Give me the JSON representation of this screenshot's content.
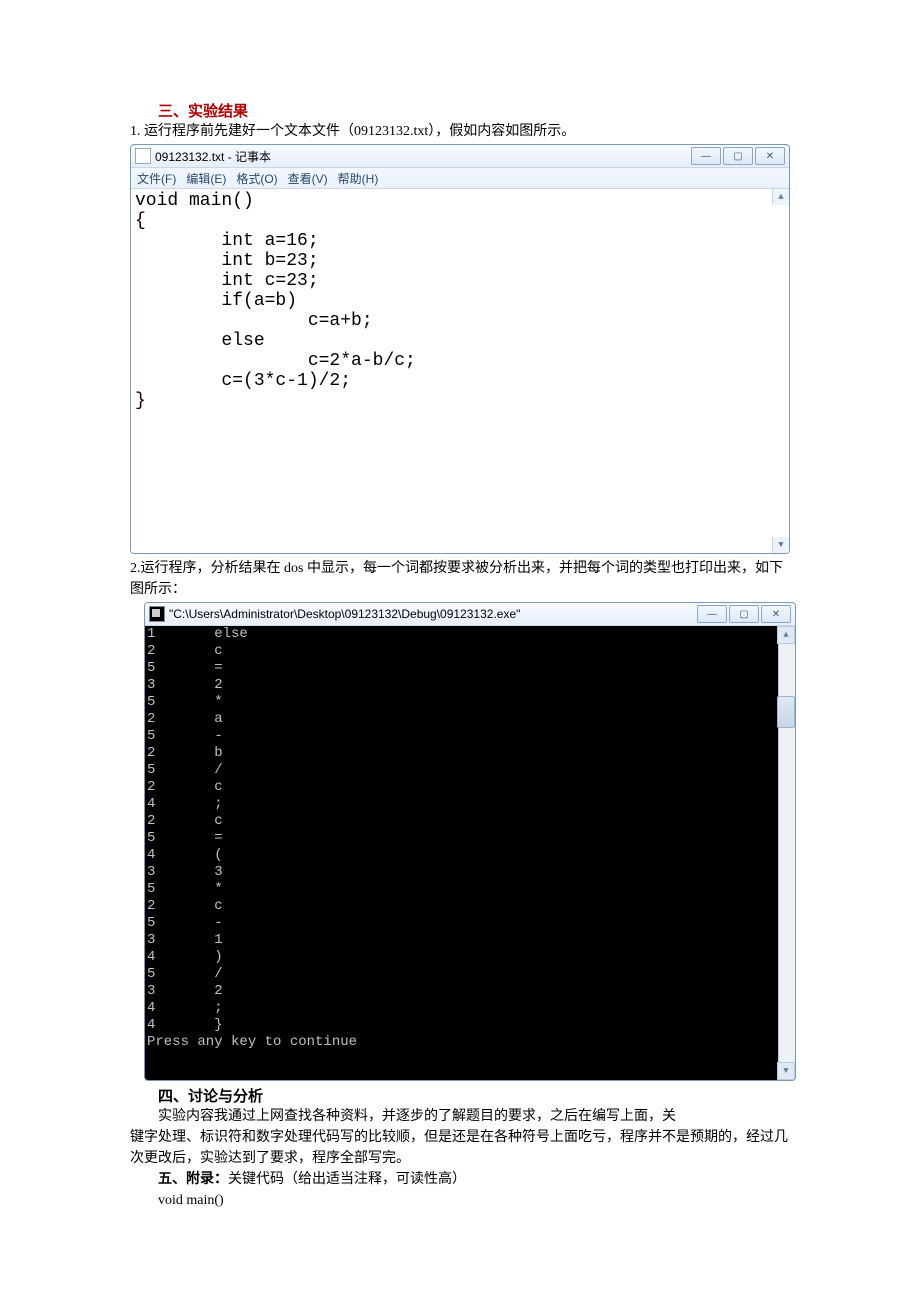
{
  "headings": {
    "h3": "三、实验结果",
    "h4": "四、讨论与分析",
    "h5_prefix": "五、附录：",
    "h5_rest": "关键代码（给出适当注释，可读性高）"
  },
  "para": {
    "p1": "1.  运行程序前先建好一个文本文件（09123132.txt），假如内容如图所示。",
    "p2": "2.运行程序，分析结果在 dos 中显示，每一个词都按要求被分析出来，并把每个词的类型也打印出来，如下图所示：",
    "p4a": "实验内容我通过上网查找各种资料，并逐步的了解题目的要求，之后在编写上面，关",
    "p4b": "键字处理、标识符和数字处理代码写的比较顺，但是还是在各种符号上面吃亏，程序并不是预期的，经过几次更改后，实验达到了要求，程序全部写完。",
    "p5_code": "void main()"
  },
  "notepad": {
    "title": "09123132.txt - 记事本",
    "menu": [
      "文件(F)",
      "编辑(E)",
      "格式(O)",
      "查看(V)",
      "帮助(H)"
    ],
    "content": "void main()\n{\n        int a=16;\n        int b=23;\n        int c=23;\n        if(a=b)\n                c=a+b;\n        else\n                c=2*a-b/c;\n        c=(3*c-1)/2;\n}"
  },
  "console": {
    "title": "\"C:\\Users\\Administrator\\Desktop\\09123132\\Debug\\09123132.exe\"",
    "lines": [
      [
        "1",
        "else"
      ],
      [
        "2",
        "c"
      ],
      [
        "5",
        "="
      ],
      [
        "3",
        "2"
      ],
      [
        "5",
        "*"
      ],
      [
        "2",
        "a"
      ],
      [
        "5",
        "-"
      ],
      [
        "2",
        "b"
      ],
      [
        "5",
        "/"
      ],
      [
        "2",
        "c"
      ],
      [
        "4",
        ";"
      ],
      [
        "2",
        "c"
      ],
      [
        "5",
        "="
      ],
      [
        "4",
        "("
      ],
      [
        "3",
        "3"
      ],
      [
        "5",
        "*"
      ],
      [
        "2",
        "c"
      ],
      [
        "5",
        "-"
      ],
      [
        "3",
        "1"
      ],
      [
        "4",
        ")"
      ],
      [
        "5",
        "/"
      ],
      [
        "3",
        "2"
      ],
      [
        "4",
        ";"
      ],
      [
        "4",
        "}"
      ]
    ],
    "footer": "Press any key to continue"
  },
  "winbtn": {
    "min": "—",
    "max": "▢",
    "close": "✕",
    "up": "▲",
    "down": "▼"
  }
}
